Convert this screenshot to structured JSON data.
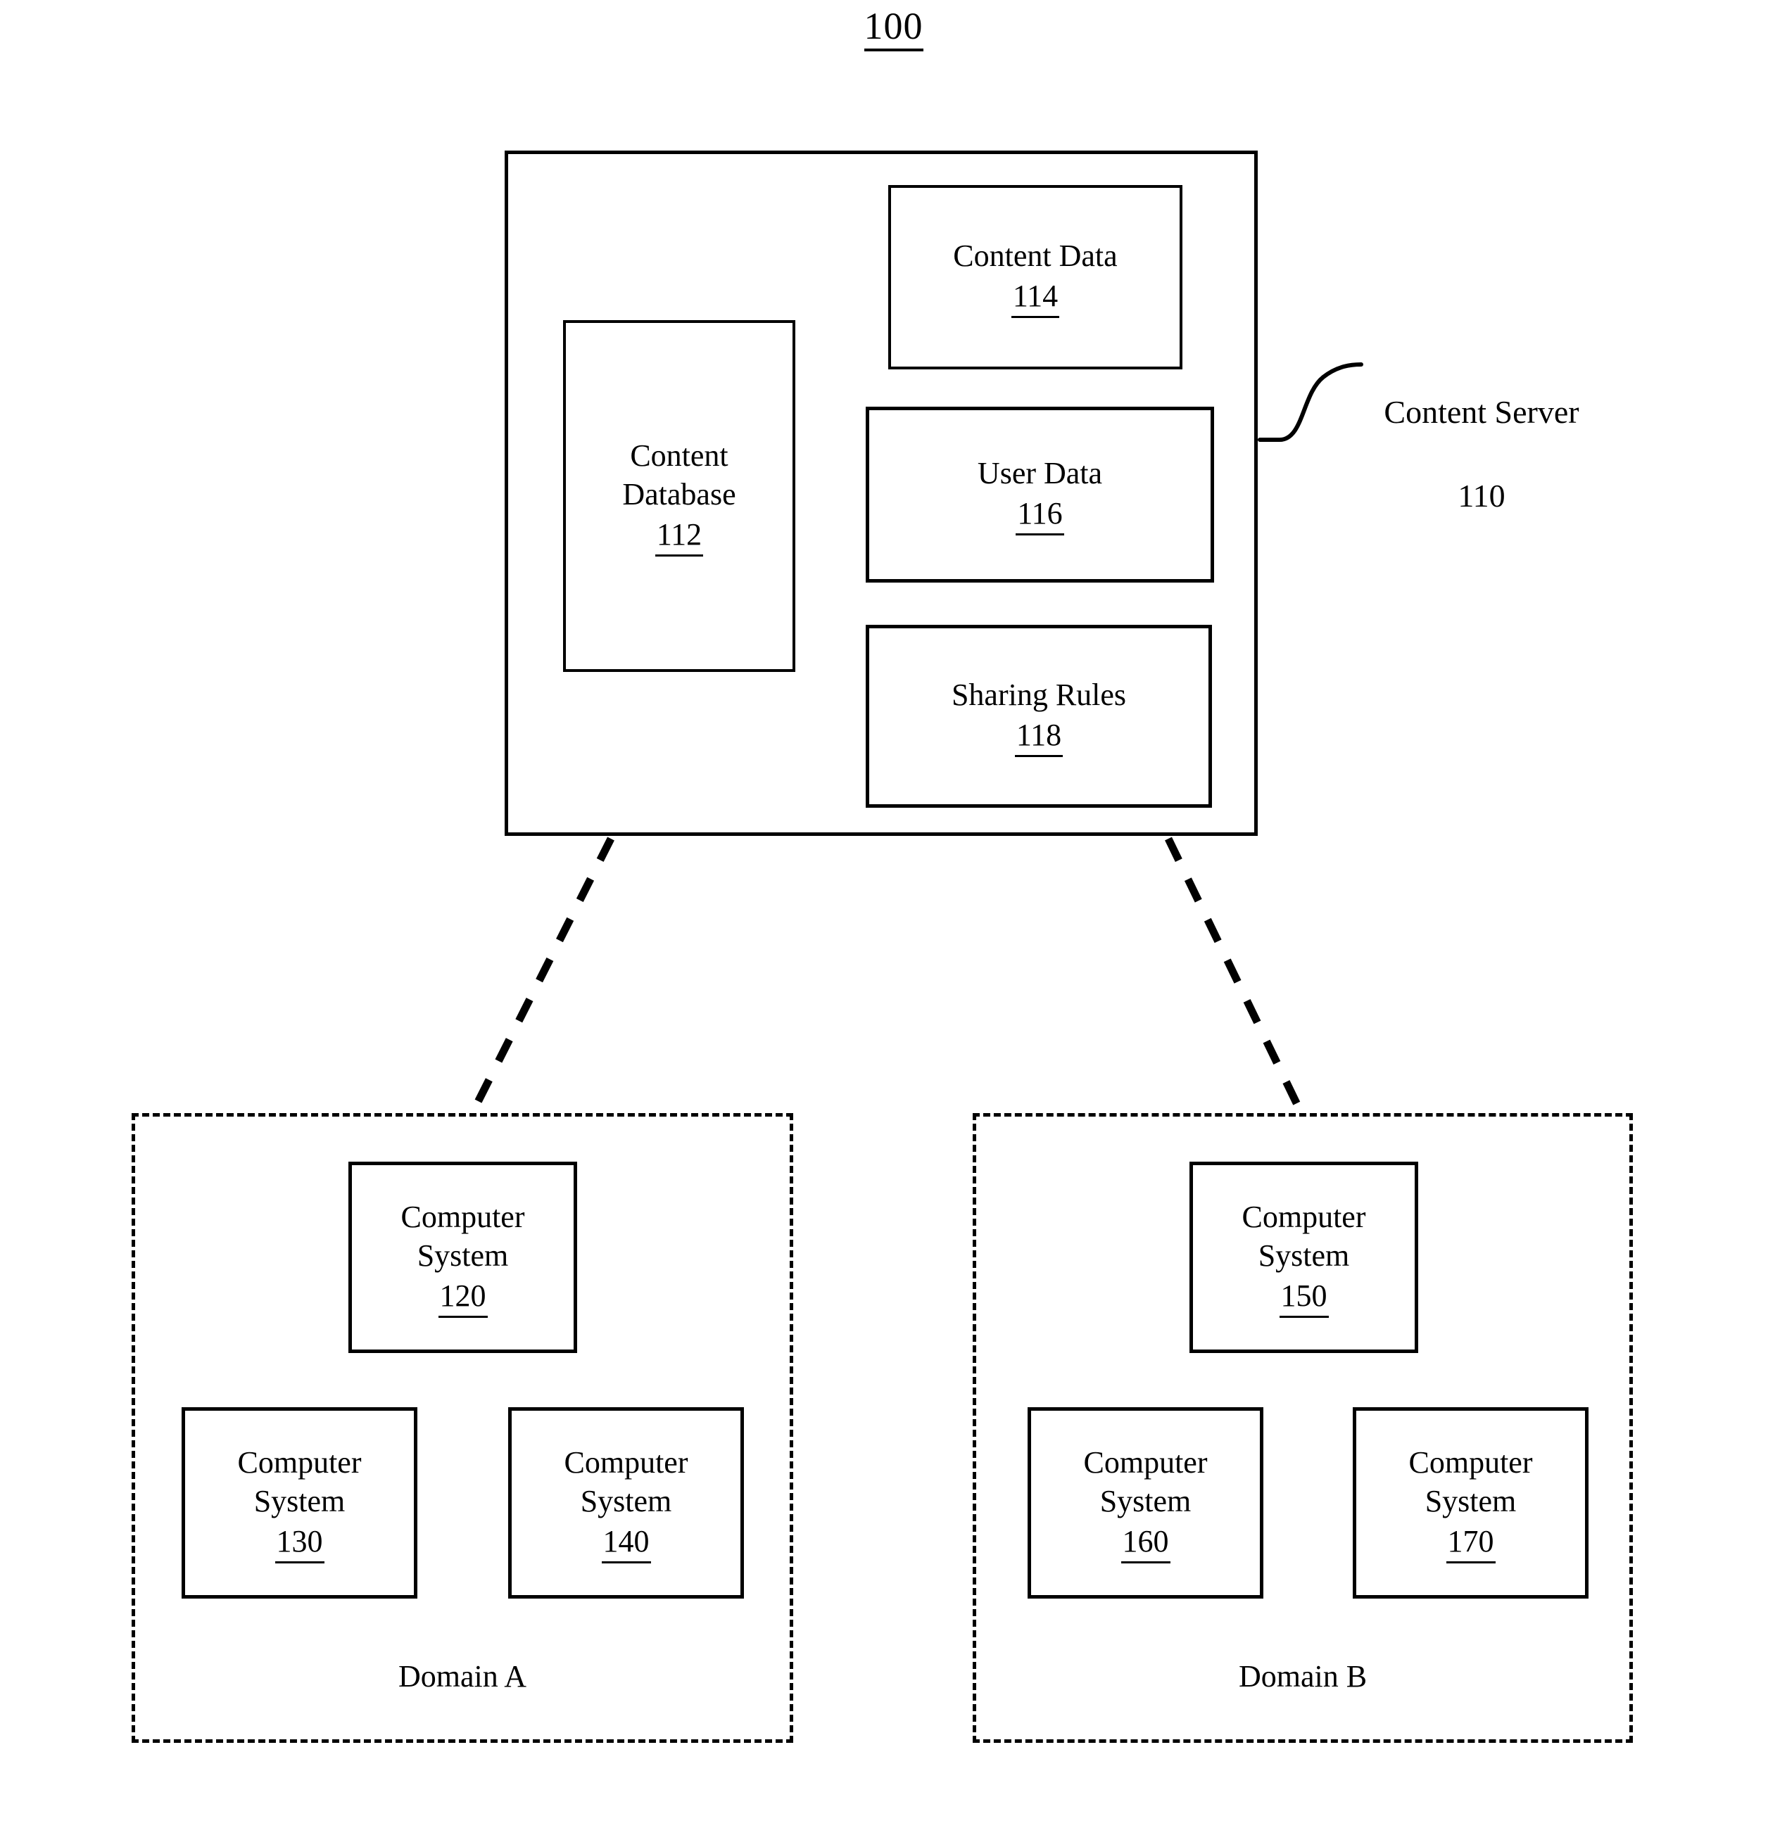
{
  "figure": {
    "number": "100"
  },
  "server": {
    "callout_name": "Content Server",
    "callout_ref": "110",
    "components": [
      {
        "name": "Content\nDatabase",
        "ref": "112"
      },
      {
        "name": "Content Data",
        "ref": "114"
      },
      {
        "name": "User Data",
        "ref": "116"
      },
      {
        "name": "Sharing Rules",
        "ref": "118"
      }
    ]
  },
  "domains": [
    {
      "label": "Domain A",
      "systems": [
        {
          "name": "Computer\nSystem",
          "ref": "120"
        },
        {
          "name": "Computer\nSystem",
          "ref": "130"
        },
        {
          "name": "Computer\nSystem",
          "ref": "140"
        }
      ]
    },
    {
      "label": "Domain B",
      "systems": [
        {
          "name": "Computer\nSystem",
          "ref": "150"
        },
        {
          "name": "Computer\nSystem",
          "ref": "160"
        },
        {
          "name": "Computer\nSystem",
          "ref": "170"
        }
      ]
    }
  ],
  "colors": {
    "stroke": "#000000",
    "background": "#ffffff"
  }
}
